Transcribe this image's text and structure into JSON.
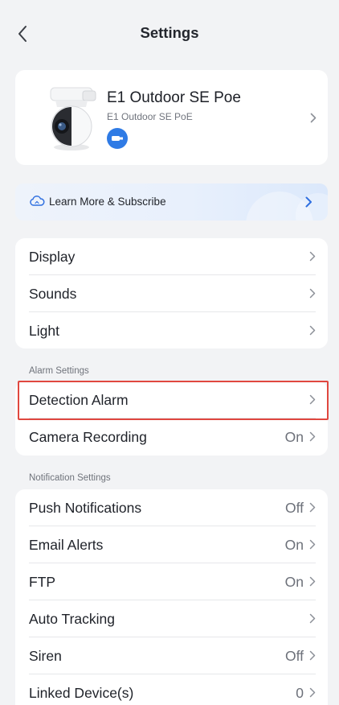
{
  "header": {
    "title": "Settings",
    "back_icon": "chevron-left-icon"
  },
  "device": {
    "name": "E1 Outdoor SE Poe",
    "model": "E1 Outdoor SE PoE",
    "badge_icon": "ethernet-icon",
    "badge_color": "#2f7be5"
  },
  "subscribe": {
    "label": "Learn More & Subscribe",
    "icon": "cloud-icon",
    "accent": "#2f6fe0"
  },
  "general": {
    "display": "Display",
    "sounds": "Sounds",
    "light": "Light"
  },
  "alarm_section": {
    "title": "Alarm Settings",
    "detection_alarm": "Detection Alarm",
    "camera_recording": "Camera Recording",
    "camera_recording_value": "On"
  },
  "notification_section": {
    "title": "Notification Settings",
    "push_notifications": "Push Notifications",
    "push_notifications_value": "Off",
    "email_alerts": "Email Alerts",
    "email_alerts_value": "On",
    "ftp": "FTP",
    "ftp_value": "On",
    "auto_tracking": "Auto Tracking",
    "siren": "Siren",
    "siren_value": "Off",
    "linked_devices": "Linked Device(s)",
    "linked_devices_value": "0"
  },
  "highlight_color": "#e0473f"
}
